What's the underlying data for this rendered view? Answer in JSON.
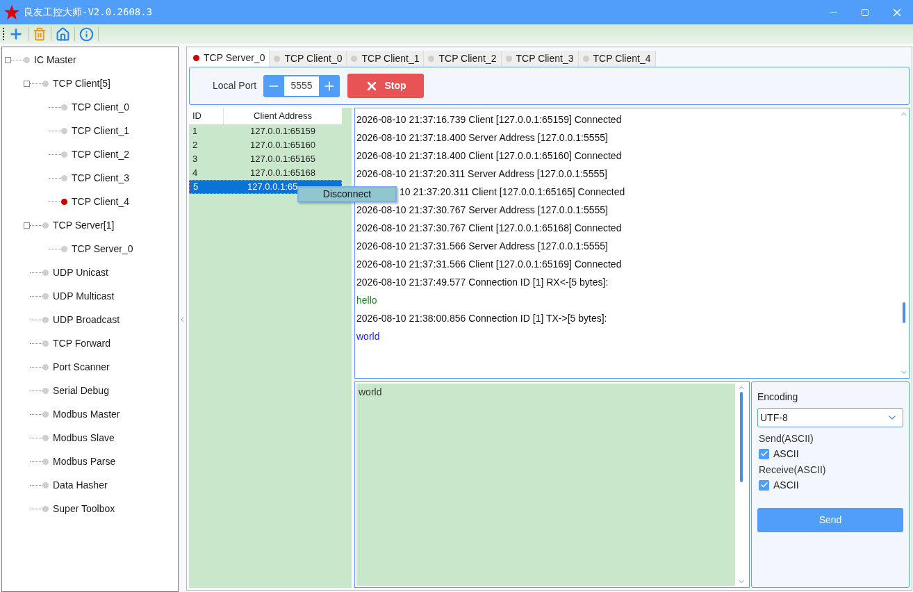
{
  "window": {
    "title": "良友工控大师-V2.0.2608.3"
  },
  "tree": [
    {
      "label": "IC Master",
      "active": false,
      "expanded": true,
      "children": [
        {
          "label": "TCP Client[5]",
          "active": false,
          "expanded": true,
          "children": [
            {
              "label": "TCP Client_0",
              "active": false
            },
            {
              "label": "TCP Client_1",
              "active": false
            },
            {
              "label": "TCP Client_2",
              "active": false
            },
            {
              "label": "TCP Client_3",
              "active": false
            },
            {
              "label": "TCP Client_4",
              "active": true
            }
          ]
        },
        {
          "label": "TCP Server[1]",
          "active": false,
          "expanded": true,
          "children": [
            {
              "label": "TCP Server_0",
              "active": false
            }
          ]
        },
        {
          "label": "UDP Unicast",
          "active": false
        },
        {
          "label": "UDP Multicast",
          "active": false
        },
        {
          "label": "UDP Broadcast",
          "active": false
        },
        {
          "label": "TCP Forward",
          "active": false
        },
        {
          "label": "Port Scanner",
          "active": false
        },
        {
          "label": "Serial Debug",
          "active": false
        },
        {
          "label": "Modbus Master",
          "active": false
        },
        {
          "label": "Modbus Slave",
          "active": false
        },
        {
          "label": "Modbus Parse",
          "active": false
        },
        {
          "label": "Data Hasher",
          "active": false
        },
        {
          "label": "Super Toolbox",
          "active": false
        }
      ]
    }
  ],
  "tabs": [
    {
      "label": "TCP Server_0",
      "selected": true,
      "active": true
    },
    {
      "label": "TCP Client_0",
      "selected": false,
      "active": false
    },
    {
      "label": "TCP Client_1",
      "selected": false,
      "active": false
    },
    {
      "label": "TCP Client_2",
      "selected": false,
      "active": false
    },
    {
      "label": "TCP Client_3",
      "selected": false,
      "active": false
    },
    {
      "label": "TCP Client_4",
      "selected": false,
      "active": false
    }
  ],
  "port": {
    "label": "Local Port",
    "value": "5555"
  },
  "stop_button": "Stop",
  "clients": {
    "columns": [
      "ID",
      "Client Address"
    ],
    "rows": [
      {
        "id": "1",
        "address": "127.0.0.1:65159",
        "selected": false
      },
      {
        "id": "2",
        "address": "127.0.0.1:65160",
        "selected": false
      },
      {
        "id": "3",
        "address": "127.0.0.1:65165",
        "selected": false
      },
      {
        "id": "4",
        "address": "127.0.0.1:65168",
        "selected": false
      },
      {
        "id": "5",
        "address": "127.0.0.1:65",
        "selected": true
      }
    ]
  },
  "context_menu": [
    "Disconnect"
  ],
  "log": [
    {
      "text": "2026-08-10 21:37:16.739 Client [127.0.0.1:65159] Connected",
      "kind": "info"
    },
    {
      "text": "2026-08-10 21:37:18.400 Server Address [127.0.0.1:5555]",
      "kind": "info"
    },
    {
      "text": "2026-08-10 21:37:18.400 Client [127.0.0.1:65160] Connected",
      "kind": "info"
    },
    {
      "text": "2026-08-10 21:37:20.311 Server Address [127.0.0.1:5555]",
      "kind": "info"
    },
    {
      "text": "10 21:37:20.311 Client [127.0.0.1:65165] Connected",
      "kind": "covered"
    },
    {
      "text": "2026-08-10 21:37:30.767 Server Address [127.0.0.1:5555]",
      "kind": "info"
    },
    {
      "text": "2026-08-10 21:37:30.767 Client [127.0.0.1:65168] Connected",
      "kind": "info"
    },
    {
      "text": "2026-08-10 21:37:31.566 Server Address [127.0.0.1:5555]",
      "kind": "info"
    },
    {
      "text": "2026-08-10 21:37:31.566 Client [127.0.0.1:65169] Connected",
      "kind": "info"
    },
    {
      "text": "2026-08-10 21:37:49.577 Connection ID [1] RX<-[5 bytes]:",
      "kind": "info"
    },
    {
      "text": "hello",
      "kind": "rx"
    },
    {
      "text": "2026-08-10 21:38:00.856 Connection ID [1] TX->[5 bytes]:",
      "kind": "info"
    },
    {
      "text": "world",
      "kind": "tx"
    }
  ],
  "send_text": "world",
  "settings": {
    "encoding_label": "Encoding",
    "encoding": "UTF-8",
    "send_label": "Send(ASCII)",
    "send_ascii": {
      "label": "ASCII",
      "checked": true
    },
    "receive_label": "Receive(ASCII)",
    "receive_ascii": {
      "label": "ASCII",
      "checked": true
    },
    "send_button": "Send"
  }
}
